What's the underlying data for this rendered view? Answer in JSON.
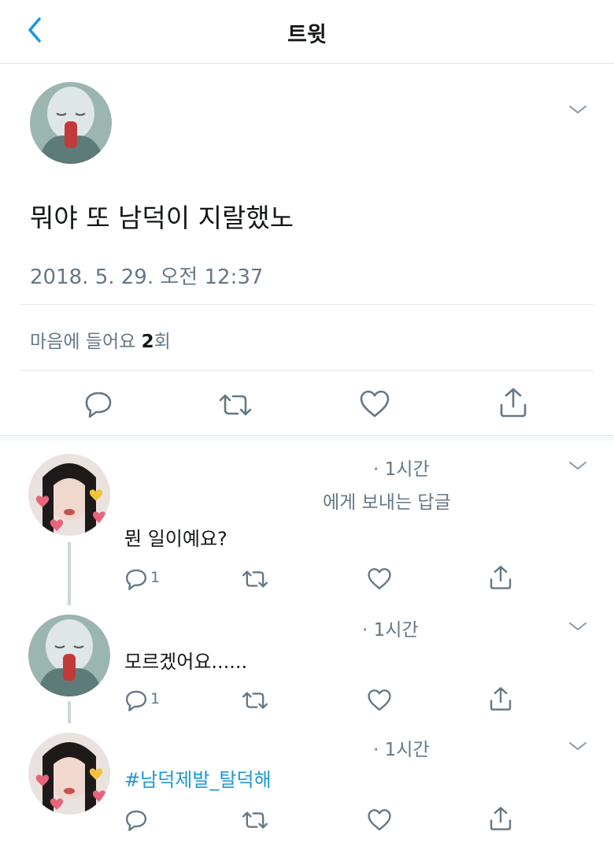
{
  "header": {
    "title": "트윗"
  },
  "main_tweet": {
    "text": "뭐야 또 남덕이 지랄했노",
    "timestamp": "2018. 5. 29. 오전 12:37",
    "likes_prefix": "마음에 들어요 ",
    "likes_count": "2",
    "likes_suffix": "회"
  },
  "replies": [
    {
      "time": "· 1시간",
      "replying_to": "에게 보내는 답글",
      "text": "뭔 일이예요?",
      "reply_count": "1"
    },
    {
      "time": "· 1시간",
      "text": "모르겠어요......",
      "reply_count": "1"
    },
    {
      "time": "· 1시간",
      "text": "#남덕제발_탈덕해"
    }
  ],
  "colors": {
    "accent": "#1b95e0",
    "muted": "#657786",
    "text": "#14171a",
    "icon": "#657786"
  }
}
